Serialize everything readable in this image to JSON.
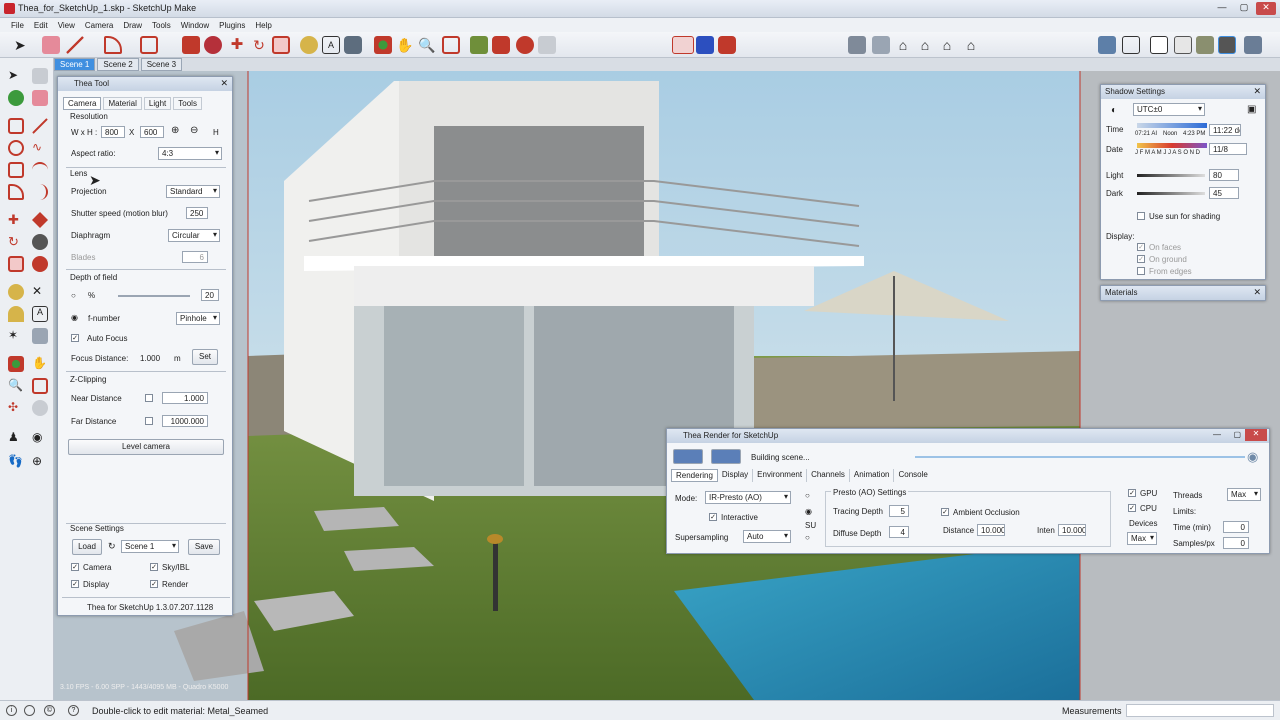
{
  "window": {
    "title": "Thea_for_SketchUp_1.skp - SketchUp Make"
  },
  "menu": [
    "File",
    "Edit",
    "View",
    "Camera",
    "Draw",
    "Tools",
    "Window",
    "Plugins",
    "Help"
  ],
  "scenes": [
    "Scene 1",
    "Scene 2",
    "Scene 3"
  ],
  "thea_tool": {
    "title": "Thea Tool",
    "tabs": [
      "Camera",
      "Material",
      "Light",
      "Tools"
    ],
    "resolution": {
      "group": "Resolution",
      "wxh_label": "W x H :",
      "w": "800",
      "x": "X",
      "h": "600",
      "h_btn": "H",
      "aspect_label": "Aspect ratio:",
      "aspect": "4:3"
    },
    "lens": {
      "group": "Lens",
      "projection_label": "Projection",
      "projection": "Standard",
      "shutter_label": "Shutter speed  (motion blur)",
      "shutter": "250",
      "diaphragm_label": "Diaphragm",
      "diaphragm": "Circular",
      "blades_label": "Blades",
      "blades": "6"
    },
    "dof": {
      "group": "Depth of field",
      "percent": "%",
      "percent_val": "20",
      "fnumber_label": "f-number",
      "fnumber": "Pinhole",
      "autofocus": "Auto Focus",
      "focus_label": "Focus Distance:",
      "focus_val": "1.000",
      "focus_unit": "m",
      "set": "Set"
    },
    "zclip": {
      "group": "Z-Clipping",
      "near_label": "Near Distance",
      "near": "1.000",
      "far_label": "Far Distance",
      "far": "1000.000"
    },
    "level_camera": "Level camera",
    "scene_settings": {
      "group": "Scene Settings",
      "load": "Load",
      "scene": "Scene 1",
      "save": "Save",
      "camera": "Camera",
      "skyibl": "Sky/IBL",
      "display": "Display",
      "render": "Render"
    },
    "version": "Thea for SketchUp 1.3.07.207.1128"
  },
  "shadow": {
    "title": "Shadow Settings",
    "utc": "UTC±0",
    "time_label": "Time",
    "time_start": "07:21 AI",
    "time_noon": "Noon",
    "time_end": "4:23 PM",
    "time_val": "11:22 de",
    "date_label": "Date",
    "months": "J F M A M J J A S O N D",
    "date_val": "11/8",
    "light_label": "Light",
    "light_val": "80",
    "dark_label": "Dark",
    "dark_val": "45",
    "use_sun": "Use sun for shading",
    "display_label": "Display:",
    "on_faces": "On faces",
    "on_ground": "On ground",
    "from_edges": "From edges"
  },
  "materials": {
    "title": "Materials"
  },
  "render": {
    "title": "Thea Render for SketchUp",
    "status": "Building scene...",
    "tabs": [
      "Rendering",
      "Display",
      "Environment",
      "Channels",
      "Animation",
      "Console"
    ],
    "mode_label": "Mode:",
    "mode": "IR-Presto (AO)",
    "interactive": "Interactive",
    "supersampling_label": "Supersampling",
    "supersampling": "Auto",
    "su": "SU",
    "presto_group": "Presto (AO) Settings",
    "tracing_label": "Tracing Depth",
    "tracing": "5",
    "diffuse_label": "Diffuse Depth",
    "diffuse": "4",
    "ao": "Ambient Occlusion",
    "distance_label": "Distance",
    "distance": "10.000",
    "inten_label": "Inten",
    "inten": "10.000",
    "gpu": "GPU",
    "cpu": "CPU",
    "devices_label": "Devices",
    "devices": "Max",
    "threads_label": "Threads",
    "threads": "Max",
    "limits_label": "Limits:",
    "time_label": "Time (min)",
    "time": "0",
    "samples_label": "Samples/px",
    "samples": "0"
  },
  "viewport": {
    "fps": "3.10 FPS - 6.00 SPP - 1443/4095 MB - Quadro K5000"
  },
  "status": {
    "message": "Double-click to edit material: Metal_Seamed",
    "measurements": "Measurements"
  },
  "colors": {
    "accent": "#3f8fe0",
    "grass": "#5f7d35",
    "sky": "#c7dde9"
  }
}
